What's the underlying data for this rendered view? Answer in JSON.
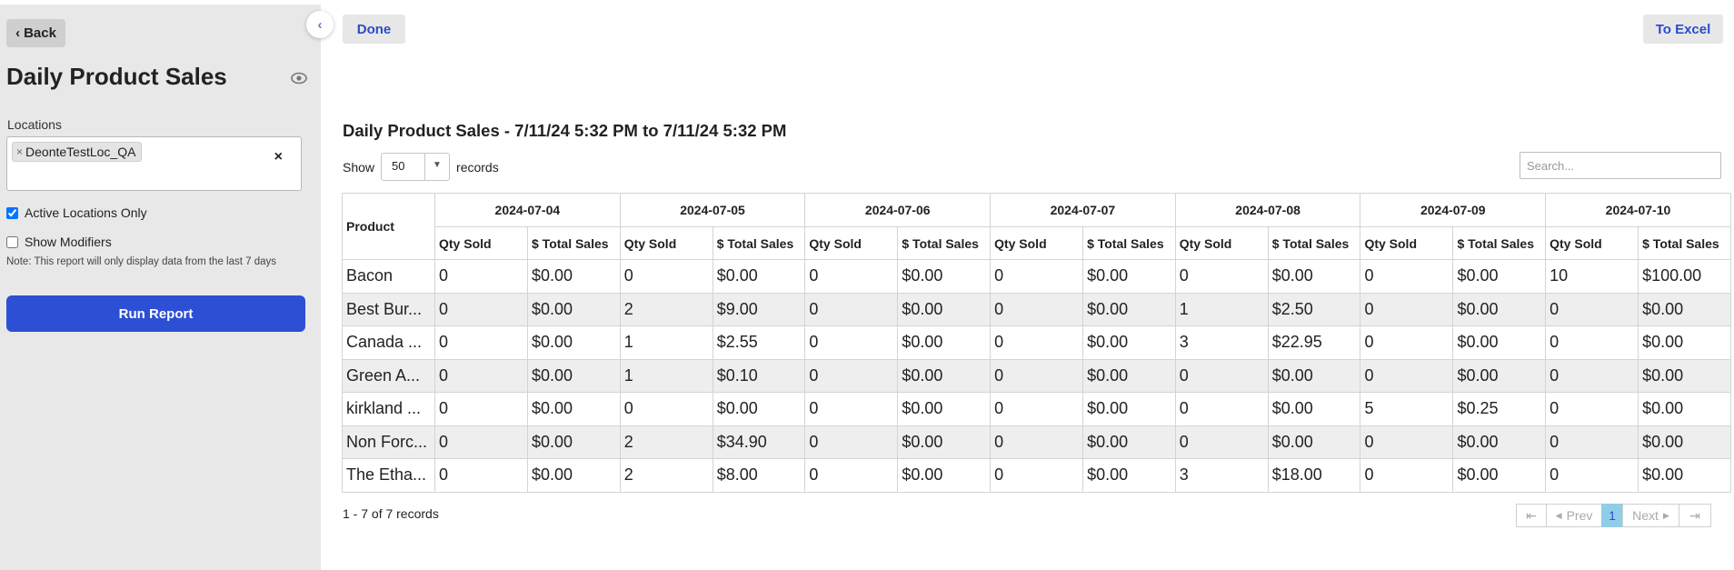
{
  "sidebar": {
    "back_label": "Back",
    "title": "Daily Product Sales",
    "locations_label": "Locations",
    "location_tag": "DeonteTestLoc_QA",
    "clear_symbol": "×",
    "active_only_label": "Active Locations Only",
    "active_only_checked": true,
    "show_modifiers_label": "Show Modifiers",
    "show_modifiers_checked": false,
    "note": "Note: This report will only display data from the last 7 days",
    "run_label": "Run Report",
    "run_color": "#2d4fd3"
  },
  "toolbar": {
    "done_label": "Done",
    "excel_label": "To Excel"
  },
  "report": {
    "title": "Daily Product Sales - 7/11/24 5:32 PM to 7/11/24 5:32 PM",
    "show_label": "Show",
    "show_value": "50",
    "records_label": "records",
    "search_placeholder": "Search..."
  },
  "table": {
    "product_header": "Product",
    "dates": [
      "2024-07-04",
      "2024-07-05",
      "2024-07-06",
      "2024-07-07",
      "2024-07-08",
      "2024-07-09",
      "2024-07-10"
    ],
    "sub_headers": [
      "Qty Sold",
      "$ Total Sales"
    ],
    "rows": [
      {
        "product": "Bacon",
        "cells": [
          "0",
          "$0.00",
          "0",
          "$0.00",
          "0",
          "$0.00",
          "0",
          "$0.00",
          "0",
          "$0.00",
          "0",
          "$0.00",
          "10",
          "$100.00"
        ]
      },
      {
        "product": "Best Bur...",
        "cells": [
          "0",
          "$0.00",
          "2",
          "$9.00",
          "0",
          "$0.00",
          "0",
          "$0.00",
          "1",
          "$2.50",
          "0",
          "$0.00",
          "0",
          "$0.00"
        ]
      },
      {
        "product": "Canada ...",
        "cells": [
          "0",
          "$0.00",
          "1",
          "$2.55",
          "0",
          "$0.00",
          "0",
          "$0.00",
          "3",
          "$22.95",
          "0",
          "$0.00",
          "0",
          "$0.00"
        ]
      },
      {
        "product": "Green A...",
        "cells": [
          "0",
          "$0.00",
          "1",
          "$0.10",
          "0",
          "$0.00",
          "0",
          "$0.00",
          "0",
          "$0.00",
          "0",
          "$0.00",
          "0",
          "$0.00"
        ]
      },
      {
        "product": "kirkland ...",
        "cells": [
          "0",
          "$0.00",
          "0",
          "$0.00",
          "0",
          "$0.00",
          "0",
          "$0.00",
          "0",
          "$0.00",
          "5",
          "$0.25",
          "0",
          "$0.00"
        ]
      },
      {
        "product": "Non Forc...",
        "cells": [
          "0",
          "$0.00",
          "2",
          "$34.90",
          "0",
          "$0.00",
          "0",
          "$0.00",
          "0",
          "$0.00",
          "0",
          "$0.00",
          "0",
          "$0.00"
        ]
      },
      {
        "product": "The Etha...",
        "cells": [
          "0",
          "$0.00",
          "2",
          "$8.00",
          "0",
          "$0.00",
          "0",
          "$0.00",
          "3",
          "$18.00",
          "0",
          "$0.00",
          "0",
          "$0.00"
        ]
      }
    ]
  },
  "footer": {
    "records_info": "1 - 7 of 7 records",
    "pager": {
      "first_icon": "first-page-icon",
      "prev_label": "Prev",
      "current_page": "1",
      "next_label": "Next",
      "last_icon": "last-page-icon"
    }
  },
  "colors": {
    "sidebar_bg": "#e8e8e8",
    "link_blue": "#2c4ccc",
    "active_page": "#8fcde9"
  }
}
